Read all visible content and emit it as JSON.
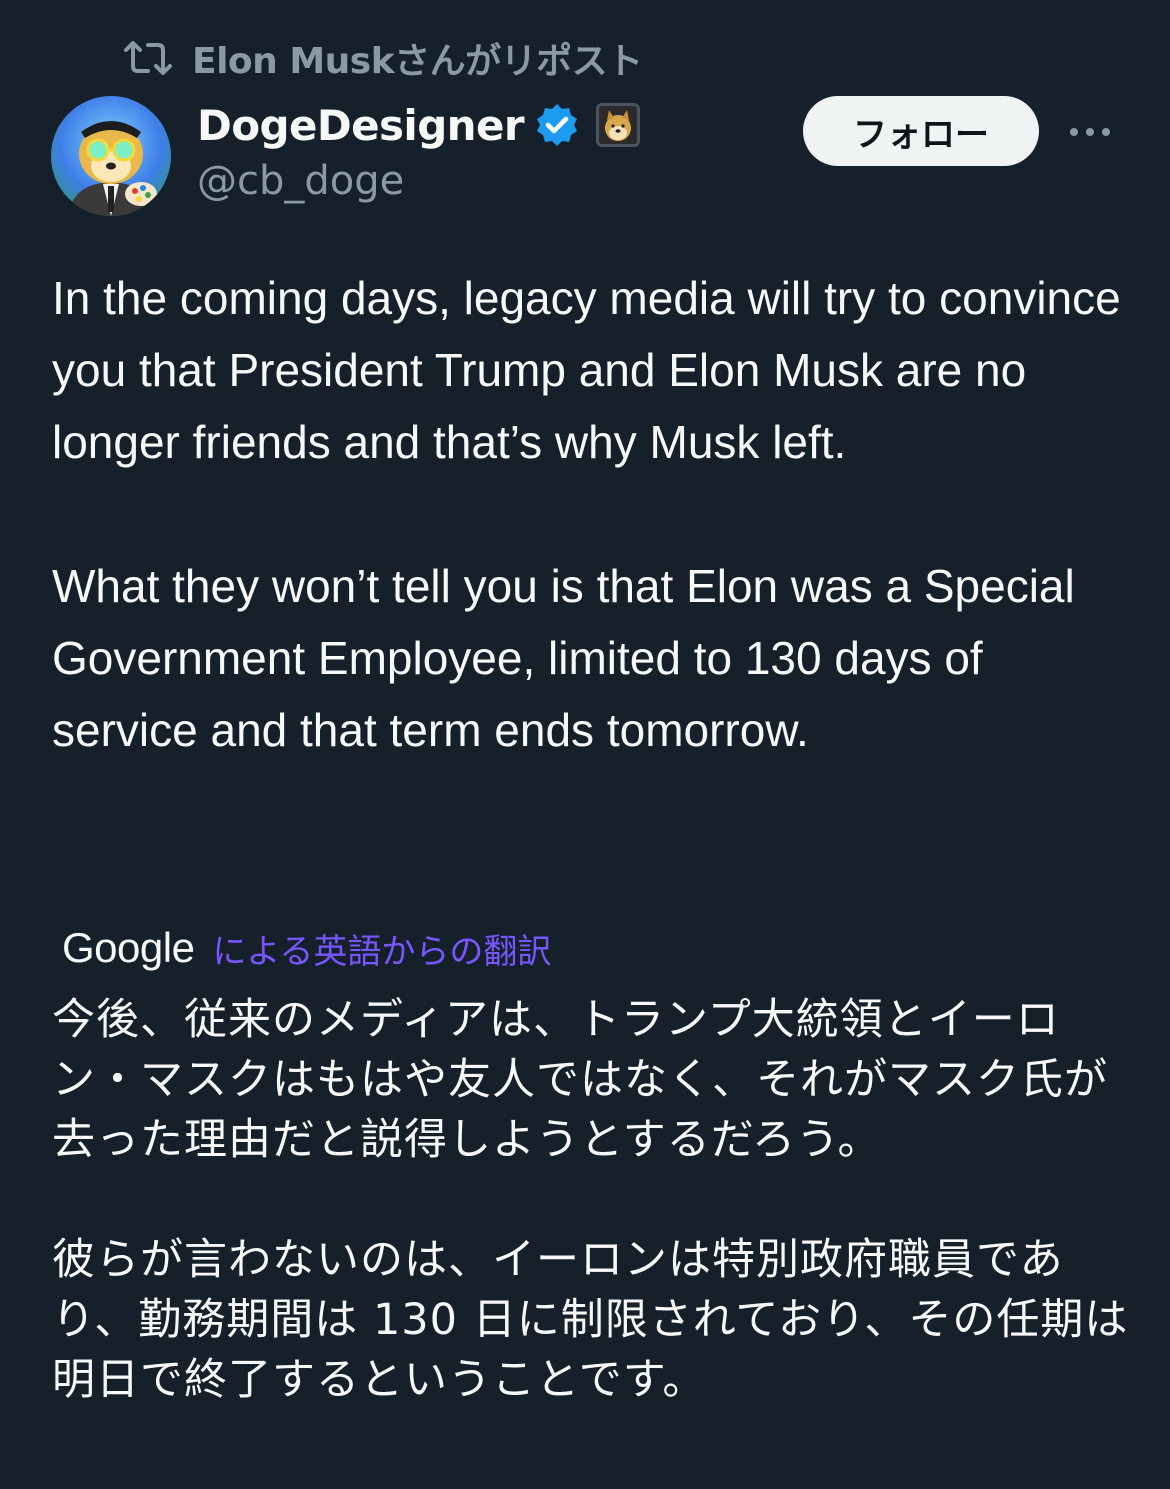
{
  "repost": {
    "icon": "repost-icon",
    "text": "Elon Muskさんがリポスト"
  },
  "author": {
    "display_name": "DogeDesigner",
    "handle": "@cb_doge",
    "verified_icon": "verified-badge-icon",
    "verified_color": "#1d9bf0",
    "affiliate_badge": "doge-affiliate-badge"
  },
  "actions": {
    "follow_label": "フォロー",
    "more_icon": "more-options-icon"
  },
  "post": {
    "paragraphs": [
      "In the coming days, legacy media will try to convince you that President Trump and Elon Musk are no longer friends and that’s why Musk left.",
      "What they won’t tell you is that Elon was a Special Government Employee, limited to 130 days of service and that term ends tomorrow."
    ]
  },
  "translation": {
    "provider": "Google",
    "label": "による英語からの翻訳",
    "label_color": "#7856ff",
    "paragraphs": [
      "今後、従来のメディアは、トランプ大統領とイーロン・マスクはもはや友人ではなく、それがマスク氏が去った理由だと説得しようとするだろう。",
      "彼らが言わないのは、イーロンは特別政府職員であり、勤務期間は 130 日に制限されており、その任期は明日で終了するということです。"
    ]
  },
  "colors": {
    "background": "#15202b",
    "text_primary": "#f7f9f9",
    "text_secondary": "#8b98a5",
    "follow_bg": "#eff3f4"
  }
}
